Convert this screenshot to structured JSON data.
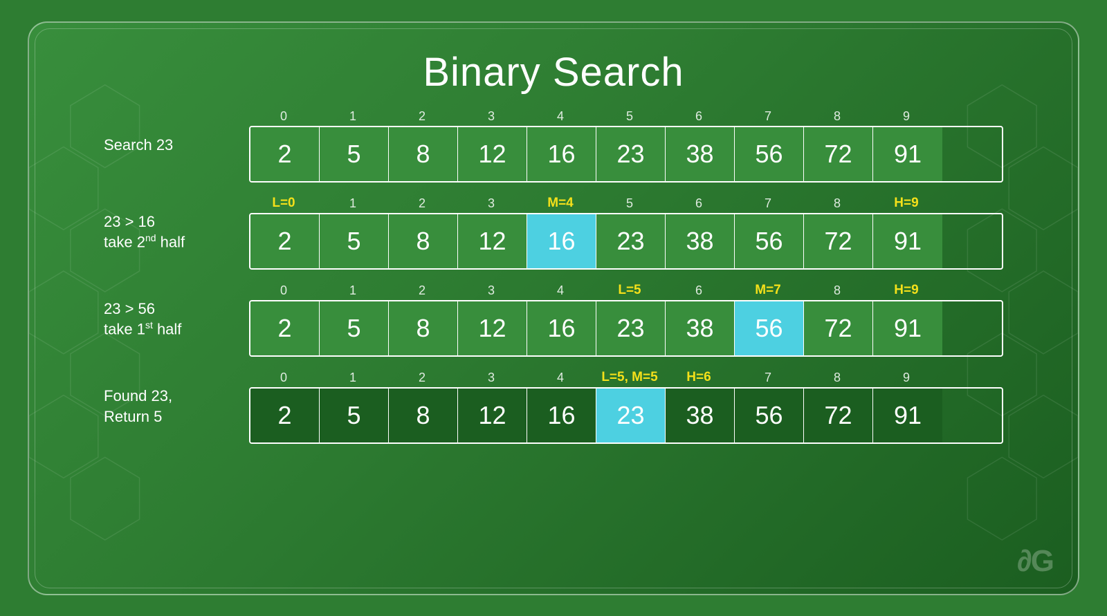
{
  "title": "Binary Search",
  "watermark": "∂G",
  "rows": [
    {
      "id": "search23",
      "label": "Search 23",
      "label_html": "Search 23",
      "indices": [
        {
          "value": "0",
          "yellow": false
        },
        {
          "value": "1",
          "yellow": false
        },
        {
          "value": "2",
          "yellow": false
        },
        {
          "value": "3",
          "yellow": false
        },
        {
          "value": "4",
          "yellow": false
        },
        {
          "value": "5",
          "yellow": false
        },
        {
          "value": "6",
          "yellow": false
        },
        {
          "value": "7",
          "yellow": false
        },
        {
          "value": "8",
          "yellow": false
        },
        {
          "value": "9",
          "yellow": false
        }
      ],
      "cells": [
        {
          "value": "2",
          "highlight": false,
          "dark": false
        },
        {
          "value": "5",
          "highlight": false,
          "dark": false
        },
        {
          "value": "8",
          "highlight": false,
          "dark": false
        },
        {
          "value": "12",
          "highlight": false,
          "dark": false
        },
        {
          "value": "16",
          "highlight": false,
          "dark": false
        },
        {
          "value": "23",
          "highlight": false,
          "dark": false
        },
        {
          "value": "38",
          "highlight": false,
          "dark": false
        },
        {
          "value": "56",
          "highlight": false,
          "dark": false
        },
        {
          "value": "72",
          "highlight": false,
          "dark": false
        },
        {
          "value": "91",
          "highlight": false,
          "dark": false
        }
      ]
    },
    {
      "id": "step1",
      "label": "23 > 16\ntake 2nd half",
      "label_html": "23 &gt; 16<br>take 2<sup>nd</sup> half",
      "indices": [
        {
          "value": "L=0",
          "yellow": true
        },
        {
          "value": "1",
          "yellow": false
        },
        {
          "value": "2",
          "yellow": false
        },
        {
          "value": "3",
          "yellow": false
        },
        {
          "value": "M=4",
          "yellow": true
        },
        {
          "value": "5",
          "yellow": false
        },
        {
          "value": "6",
          "yellow": false
        },
        {
          "value": "7",
          "yellow": false
        },
        {
          "value": "8",
          "yellow": false
        },
        {
          "value": "H=9",
          "yellow": true
        }
      ],
      "cells": [
        {
          "value": "2",
          "highlight": false,
          "dark": false
        },
        {
          "value": "5",
          "highlight": false,
          "dark": false
        },
        {
          "value": "8",
          "highlight": false,
          "dark": false
        },
        {
          "value": "12",
          "highlight": false,
          "dark": false
        },
        {
          "value": "16",
          "highlight": true,
          "dark": false
        },
        {
          "value": "23",
          "highlight": false,
          "dark": false
        },
        {
          "value": "38",
          "highlight": false,
          "dark": false
        },
        {
          "value": "56",
          "highlight": false,
          "dark": false
        },
        {
          "value": "72",
          "highlight": false,
          "dark": false
        },
        {
          "value": "91",
          "highlight": false,
          "dark": false
        }
      ]
    },
    {
      "id": "step2",
      "label": "23 > 56\ntake 1st half",
      "label_html": "23 &gt; 56<br>take 1<sup>st</sup> half",
      "indices": [
        {
          "value": "0",
          "yellow": false
        },
        {
          "value": "1",
          "yellow": false
        },
        {
          "value": "2",
          "yellow": false
        },
        {
          "value": "3",
          "yellow": false
        },
        {
          "value": "4",
          "yellow": false
        },
        {
          "value": "L=5",
          "yellow": true
        },
        {
          "value": "6",
          "yellow": false
        },
        {
          "value": "M=7",
          "yellow": true
        },
        {
          "value": "8",
          "yellow": false
        },
        {
          "value": "H=9",
          "yellow": true
        }
      ],
      "cells": [
        {
          "value": "2",
          "highlight": false,
          "dark": false
        },
        {
          "value": "5",
          "highlight": false,
          "dark": false
        },
        {
          "value": "8",
          "highlight": false,
          "dark": false
        },
        {
          "value": "12",
          "highlight": false,
          "dark": false
        },
        {
          "value": "16",
          "highlight": false,
          "dark": false
        },
        {
          "value": "23",
          "highlight": false,
          "dark": false
        },
        {
          "value": "38",
          "highlight": false,
          "dark": false
        },
        {
          "value": "56",
          "highlight": true,
          "dark": false
        },
        {
          "value": "72",
          "highlight": false,
          "dark": false
        },
        {
          "value": "91",
          "highlight": false,
          "dark": false
        }
      ]
    },
    {
      "id": "step3",
      "label": "Found 23,\nReturn 5",
      "label_html": "Found 23,<br>Return 5",
      "indices": [
        {
          "value": "0",
          "yellow": false
        },
        {
          "value": "1",
          "yellow": false
        },
        {
          "value": "2",
          "yellow": false
        },
        {
          "value": "3",
          "yellow": false
        },
        {
          "value": "4",
          "yellow": false
        },
        {
          "value": "L=5, M=5",
          "yellow": true
        },
        {
          "value": "H=6",
          "yellow": true
        },
        {
          "value": "7",
          "yellow": false
        },
        {
          "value": "8",
          "yellow": false
        },
        {
          "value": "9",
          "yellow": false
        }
      ],
      "cells": [
        {
          "value": "2",
          "highlight": false,
          "dark": true
        },
        {
          "value": "5",
          "highlight": false,
          "dark": true
        },
        {
          "value": "8",
          "highlight": false,
          "dark": true
        },
        {
          "value": "12",
          "highlight": false,
          "dark": true
        },
        {
          "value": "16",
          "highlight": false,
          "dark": true
        },
        {
          "value": "23",
          "highlight": true,
          "dark": false
        },
        {
          "value": "38",
          "highlight": false,
          "dark": true
        },
        {
          "value": "56",
          "highlight": false,
          "dark": true
        },
        {
          "value": "72",
          "highlight": false,
          "dark": true
        },
        {
          "value": "91",
          "highlight": false,
          "dark": true
        }
      ]
    }
  ]
}
